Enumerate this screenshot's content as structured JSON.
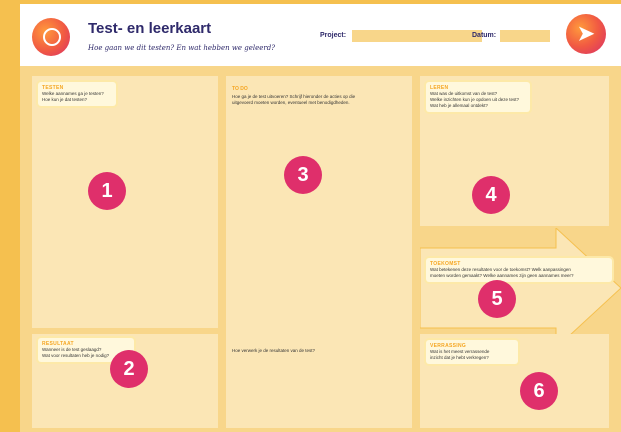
{
  "header": {
    "title": "Test- en leerkaart",
    "subtitle": "Hoe gaan we dit testen? En wat hebben we geleerd?",
    "project_label": "Project:",
    "datum_label": "Datum:"
  },
  "panels": {
    "testen": {
      "title": "TESTEN",
      "lines": [
        "Welke aannames ga je testen?",
        "Hoe kun je dat testen?"
      ],
      "number": "1"
    },
    "resultaat": {
      "title": "RESULTAAT",
      "lines": [
        "Wanneer is de test geslaagd?",
        "Wat voor resultaten heb je nodig?"
      ],
      "number": "2"
    },
    "todo": {
      "title": "TO DO",
      "lines": [
        "Hoe ga je de test uitvoeren? Schrijf hieronder de acties op die",
        "uitgevoerd moeten worden, eventueel met benodigdheden."
      ],
      "question2": "Hoe verwerk je de resultaten van de test?",
      "number": "3"
    },
    "leren": {
      "title": "LEREN",
      "lines": [
        "Wat was de uitkomst van de test?",
        "Welke inzichten kun je opdoen uit deze test?",
        "Wat heb je allemaal ontdekt?"
      ],
      "number": "4"
    },
    "toekomst": {
      "title": "TOEKOMST",
      "lines": [
        "Wat betekenen deze resultaten voor de toekomst? Welk aanpassingen",
        "moeten worden gemaakt? Welke aannames zijn geen aannames meer?"
      ],
      "number": "5"
    },
    "verrassing": {
      "title": "VERRASSING",
      "lines": [
        "Wat is het meest verrassende",
        "inzicht dat je hebt verkregen?"
      ],
      "number": "6"
    }
  },
  "colors": {
    "accent": "#df2f6b",
    "title": "#2f2a6b",
    "label": "#f5a623",
    "background": "#f5c04f"
  }
}
